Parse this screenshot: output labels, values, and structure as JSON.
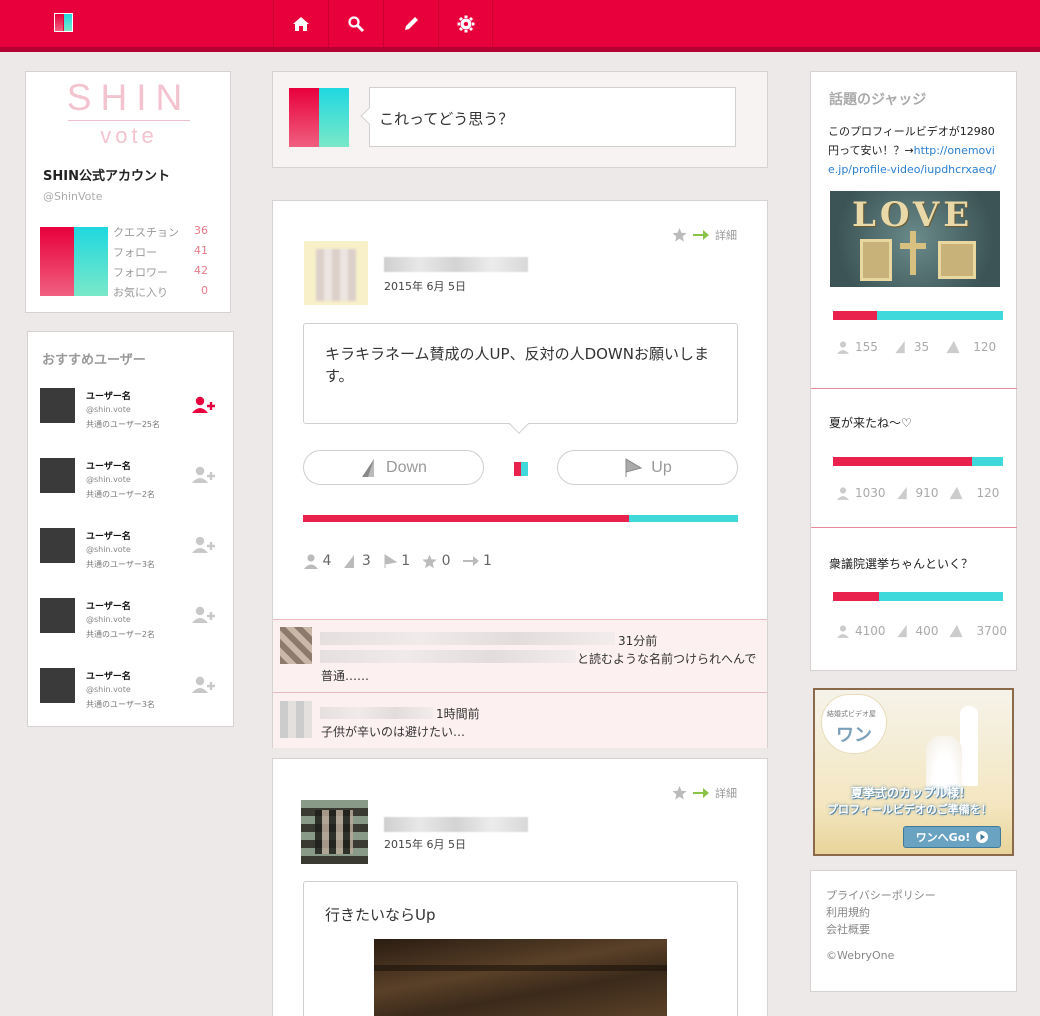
{
  "colors": {
    "brand": "#e8003c",
    "brand_dark": "#b40030",
    "cyan": "#3fd9dc",
    "bg": "#ede9e8"
  },
  "nav": {
    "items": [
      {
        "name": "home-icon",
        "icon": "home"
      },
      {
        "name": "search-icon",
        "icon": "search"
      },
      {
        "name": "pencil-icon",
        "icon": "edit"
      },
      {
        "name": "gear-icon",
        "icon": "settings"
      }
    ]
  },
  "profile": {
    "logo_top": "SHIN",
    "logo_bottom": "vote",
    "name": "SHIN公式アカウント",
    "handle": "@ShinVote",
    "stats": [
      {
        "label": "クエスチョン",
        "value": "36"
      },
      {
        "label": "フォロー",
        "value": "41"
      },
      {
        "label": "フォロワー",
        "value": "42"
      },
      {
        "label": "お気に入り",
        "value": "0"
      }
    ]
  },
  "recommended": {
    "title": "おすすめユーザー",
    "users": [
      {
        "name": "ユーザー名",
        "handle": "@shin.vote",
        "common": "共通のユーザー25名",
        "active": true
      },
      {
        "name": "ユーザー名",
        "handle": "@shin.vote",
        "common": "共通のユーザー2名",
        "active": false
      },
      {
        "name": "ユーザー名",
        "handle": "@shin.vote",
        "common": "共通のユーザー3名",
        "active": false
      },
      {
        "name": "ユーザー名",
        "handle": "@shin.vote",
        "common": "共通のユーザー2名",
        "active": false
      },
      {
        "name": "ユーザー名",
        "handle": "@shin.vote",
        "common": "共通のユーザー3名",
        "active": false
      }
    ]
  },
  "composer": {
    "placeholder": "これってどう思う？"
  },
  "posts": [
    {
      "detail": "詳細",
      "date": "2015年 6月 5日",
      "question": "キラキラネーム賛成の人UP、反対の人DOWNお願いします。",
      "down_label": "Down",
      "up_label": "Up",
      "down_ratio": 0.75,
      "stats": {
        "users": "4",
        "down": "3",
        "up": "1",
        "fav": "0",
        "share": "1"
      },
      "comments": [
        {
          "time": "31分前",
          "text_tail": "と読むような名前つけられへんで",
          "text2": "普通……"
        },
        {
          "time": "1時間前",
          "text": "子供が辛いのは避けたい…"
        }
      ]
    },
    {
      "detail": "詳細",
      "date": "2015年 6月 5日",
      "question": "行きたいならUp"
    }
  ],
  "trending": {
    "title": "話題のジャッジ",
    "items": [
      {
        "text_a": "このプロフィールビデオが12980円って安い！？→",
        "link": "http://onemovie.jp/profile-video/iupdhcrxaeq/",
        "image_text": "LOVE",
        "down_ratio": 0.26,
        "stats": [
          "155",
          "35",
          "120"
        ]
      },
      {
        "text": "夏が来たね～♡",
        "down_ratio": 0.82,
        "stats": [
          "1030",
          "910",
          "120"
        ]
      },
      {
        "text": "衆議院選挙ちゃんといく？",
        "down_ratio": 0.27,
        "stats": [
          "4100",
          "400",
          "3700"
        ]
      }
    ]
  },
  "ad": {
    "badge": "結婚式ビデオ屋",
    "brand": "ワン",
    "line1": "夏挙式のカップル様！",
    "line2": "プロフィールビデオのご準備を！",
    "cta": "ワンへGo!"
  },
  "footer": {
    "links": [
      "プライバシーポリシー",
      "利用規約",
      "会社概要"
    ],
    "copyright": "©WebryOne"
  }
}
